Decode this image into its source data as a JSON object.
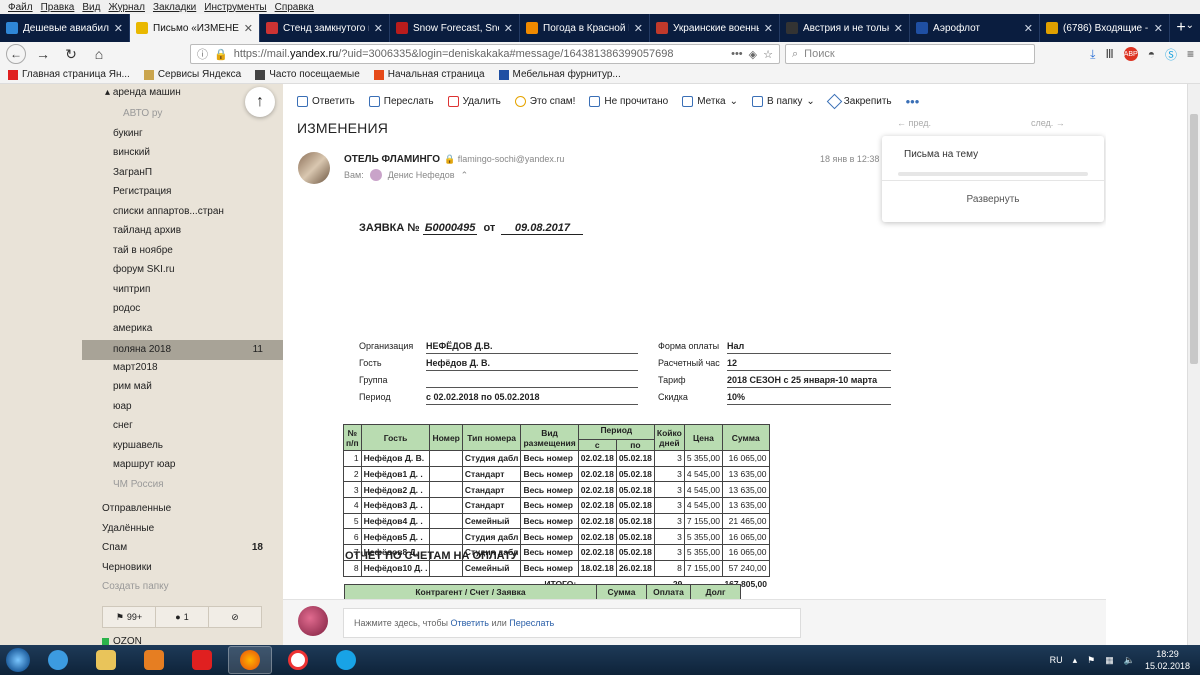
{
  "menubar": [
    "Файл",
    "Правка",
    "Вид",
    "Журнал",
    "Закладки",
    "Инструменты",
    "Справка"
  ],
  "tabs": [
    {
      "label": "Дешевые авиабилет",
      "color": "#2f86d6",
      "active": false
    },
    {
      "label": "Письмо «ИЗМЕНЕНИ",
      "color": "#e9b800",
      "active": true
    },
    {
      "label": "Стенд замкнутого ци",
      "color": "#cc3333",
      "active": false
    },
    {
      "label": "Snow Forecast, Snow",
      "color": "#b91c1c",
      "active": false
    },
    {
      "label": "Погода в Красной П",
      "color": "#f08a00",
      "active": false
    },
    {
      "label": "Украинские военны",
      "color": "#c0392b",
      "active": false
    },
    {
      "label": "Австрия и не только",
      "color": "#333333",
      "active": false
    },
    {
      "label": "Аэрофлот",
      "color": "#1f4fa3",
      "active": false
    },
    {
      "label": "(6786) Входящие - П",
      "color": "#e0a000",
      "active": false
    }
  ],
  "address": {
    "prefix": "https://mail.",
    "host": "yandex.ru",
    "rest": "/?uid=3006335&login=deniskakaka#message/164381386399057698"
  },
  "search_placeholder": "Поиск",
  "bookmarks": [
    "Главная страница Ян...",
    "Сервисы Яндекса",
    "Часто посещаемые",
    "Начальная страница",
    "Мебельная фурнитур..."
  ],
  "sidebar": {
    "top_folder": "аренда машин",
    "folders": [
      "АВТО ру",
      "букинг",
      "винский",
      "ЗагранП",
      "Регистрация",
      "списки аппартов...стран",
      "тайланд архив",
      "тай в ноябре",
      "форум SKI.ru",
      "чиптрип",
      "родос",
      "америка",
      "поляна 2018",
      "март2018",
      "рим май",
      "юар",
      "снег",
      "куршавель",
      "маршрут юар",
      "ЧМ Россия"
    ],
    "selected": {
      "label": "поляна 2018",
      "count": "11"
    },
    "system": [
      {
        "label": "Отправленные",
        "count": ""
      },
      {
        "label": "Удалённые",
        "count": ""
      },
      {
        "label": "Спам",
        "count": "18"
      },
      {
        "label": "Черновики",
        "count": ""
      },
      {
        "label": "Создать папку",
        "count": ""
      }
    ],
    "footer": [
      "99+",
      "1",
      ""
    ],
    "ozon": "OZON"
  },
  "toolbar": [
    "Ответить",
    "Переслать",
    "Удалить",
    "Это спам!",
    "Не прочитано",
    "Метка",
    "В папку",
    "Закрепить"
  ],
  "subject": "ИЗМЕНЕНИЯ",
  "sender": {
    "name": "ОТЕЛЬ ФЛАМИНГО",
    "email": "flamingo-sochi@yandex.ru",
    "to_label": "Вам:",
    "to_name": "Денис Нефедов",
    "date": "18 янв в 12:38"
  },
  "prevnext": {
    "prev": "пред.",
    "next": "след."
  },
  "thread": {
    "title": "Письма на тему",
    "expand": "Развернуть"
  },
  "application": {
    "title": "ЗАЯВКА №",
    "number": "Б0000495",
    "from": "от",
    "date": "09.08.2017",
    "left": [
      {
        "k": "Организация",
        "v": "НЕФЁДОВ Д.В."
      },
      {
        "k": "Гость",
        "v": "Нефёдов Д. В."
      },
      {
        "k": "Группа",
        "v": ""
      },
      {
        "k": "Период",
        "v": "с 02.02.2018 по 05.02.2018"
      }
    ],
    "right": [
      {
        "k": "Форма оплаты",
        "v": "Нал"
      },
      {
        "k": "Расчетный час",
        "v": "12"
      },
      {
        "k": "Тариф",
        "v": "2018 СЕЗОН с 25 января-10 марта"
      },
      {
        "k": "Скидка",
        "v": "10%"
      }
    ],
    "headers": {
      "no": "№",
      "no2": "п/п",
      "guest": "Гость",
      "room": "Номер",
      "type": "Тип номера",
      "kind": "Вид",
      "kind2": "размещения",
      "period": "Период",
      "from": "с",
      "to": "по",
      "days": "Койко",
      "days2": "дней",
      "price": "Цена",
      "sum": "Сумма"
    },
    "rows": [
      [
        "1",
        "Нефёдов Д. В.",
        "",
        "Студия дабл",
        "Весь номер",
        "02.02.18",
        "05.02.18",
        "3",
        "5 355,00",
        "16 065,00"
      ],
      [
        "2",
        "Нефёдов1 Д. .",
        "",
        "Стандарт",
        "Весь номер",
        "02.02.18",
        "05.02.18",
        "3",
        "4 545,00",
        "13 635,00"
      ],
      [
        "3",
        "Нефёдов2 Д. .",
        "",
        "Стандарт",
        "Весь номер",
        "02.02.18",
        "05.02.18",
        "3",
        "4 545,00",
        "13 635,00"
      ],
      [
        "4",
        "Нефёдов3 Д. .",
        "",
        "Стандарт",
        "Весь номер",
        "02.02.18",
        "05.02.18",
        "3",
        "4 545,00",
        "13 635,00"
      ],
      [
        "5",
        "Нефёдов4 Д. .",
        "",
        "Семейный",
        "Весь номер",
        "02.02.18",
        "05.02.18",
        "3",
        "7 155,00",
        "21 465,00"
      ],
      [
        "6",
        "Нефёдов5 Д. .",
        "",
        "Студия дабл",
        "Весь номер",
        "02.02.18",
        "05.02.18",
        "3",
        "5 355,00",
        "16 065,00"
      ],
      [
        "7",
        "Нефёдов8 Д. .",
        "",
        "Студия дабл",
        "Весь номер",
        "02.02.18",
        "05.02.18",
        "3",
        "5 355,00",
        "16 065,00"
      ],
      [
        "8",
        "Нефёдов10 Д. .",
        "",
        "Семейный",
        "Весь номер",
        "18.02.18",
        "26.02.18",
        "8",
        "7 155,00",
        "57 240,00"
      ]
    ],
    "total_label": "ИТОГО:",
    "total_days": "29",
    "total_sum": "167 805,00"
  },
  "report": {
    "title": "ОТЧЕТ ПО СЧЕТАМ НА ОПЛАТУ",
    "headers": [
      "Контрагент / Счет / Заявка",
      "Сумма",
      "Оплата",
      "Долг"
    ]
  },
  "reply": {
    "prefix": "Нажмите здесь, чтобы ",
    "reply": "Ответить",
    "or": " или ",
    "forward": "Переслать"
  },
  "tray": {
    "lang": "RU",
    "time": "18:29",
    "date": "15.02.2018"
  }
}
